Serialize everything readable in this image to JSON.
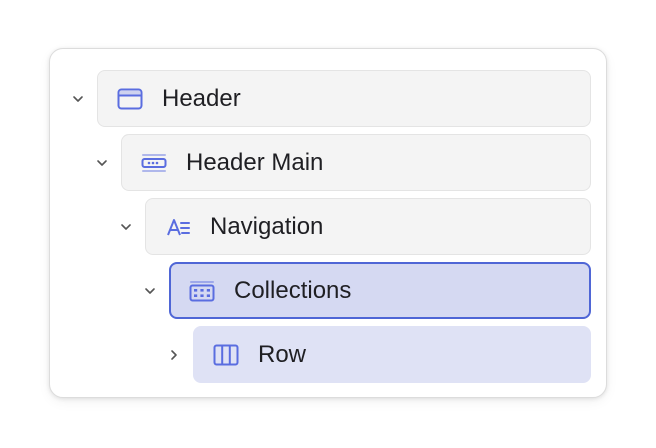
{
  "tree": {
    "items": [
      {
        "label": "Header",
        "icon": "browser-window-icon",
        "expanded": true,
        "depth": 0
      },
      {
        "label": "Header Main",
        "icon": "header-bar-icon",
        "expanded": true,
        "depth": 1
      },
      {
        "label": "Navigation",
        "icon": "text-align-icon",
        "expanded": true,
        "depth": 2
      },
      {
        "label": "Collections",
        "icon": "grid-list-icon",
        "expanded": true,
        "depth": 3,
        "selected": true
      },
      {
        "label": "Row",
        "icon": "columns-icon",
        "expanded": false,
        "depth": 4
      }
    ]
  },
  "colors": {
    "icon": "#5a6de0",
    "selected_bg": "#d5d9f2",
    "selected_border": "#4f66d6",
    "child_bg": "#dfe2f5",
    "tile_bg": "#f4f4f4"
  }
}
